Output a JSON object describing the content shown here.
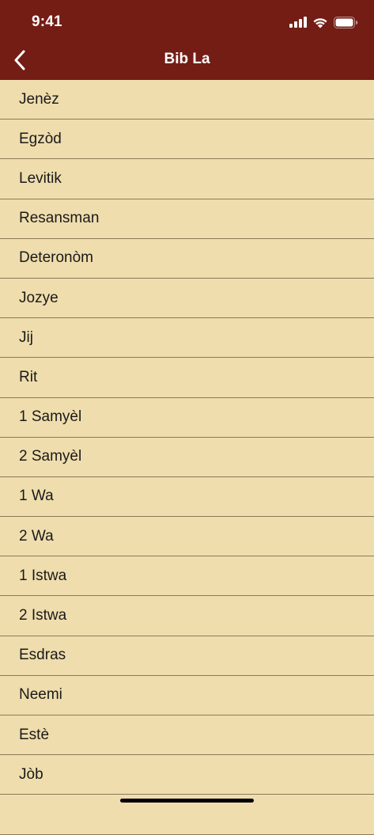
{
  "status_bar": {
    "time": "9:41"
  },
  "nav": {
    "title": "Bib La",
    "back_icon": "chevron-left-icon"
  },
  "colors": {
    "header_background": "#731D15",
    "list_background": "#EFDDAD",
    "divider": "#8C7A5A"
  },
  "books": [
    {
      "label": "Jenèz"
    },
    {
      "label": "Egzòd"
    },
    {
      "label": "Levitik"
    },
    {
      "label": "Resansman"
    },
    {
      "label": "Deteronòm"
    },
    {
      "label": "Jozye"
    },
    {
      "label": "Jij"
    },
    {
      "label": "Rit"
    },
    {
      "label": "1 Samyèl"
    },
    {
      "label": "2 Samyèl"
    },
    {
      "label": "1 Wa"
    },
    {
      "label": "2 Wa"
    },
    {
      "label": "1 Istwa"
    },
    {
      "label": "2 Istwa"
    },
    {
      "label": "Esdras"
    },
    {
      "label": "Neemi"
    },
    {
      "label": "Estè"
    },
    {
      "label": "Jòb"
    },
    {
      "label": ""
    }
  ]
}
